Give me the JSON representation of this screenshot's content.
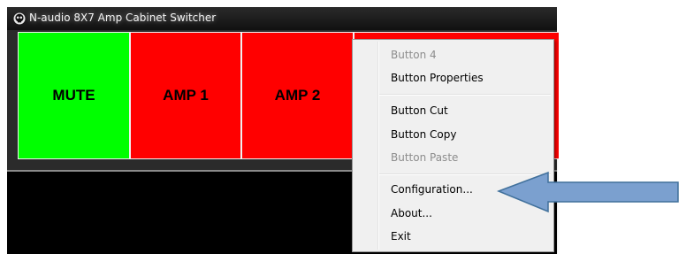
{
  "window": {
    "title": "N-audio 8X7 Amp Cabinet Switcher",
    "icon": "skull-icon"
  },
  "buttons": [
    {
      "label": "MUTE",
      "color": "#00ff00"
    },
    {
      "label": "AMP 1",
      "color": "#ff0000"
    },
    {
      "label": "AMP 2",
      "color": "#ff0000"
    }
  ],
  "context_menu": {
    "items": [
      {
        "label": "Button 4",
        "enabled": false
      },
      {
        "label": "Button Properties",
        "enabled": true
      },
      {
        "label": "Button Cut",
        "enabled": true
      },
      {
        "label": "Button Copy",
        "enabled": true
      },
      {
        "label": "Button Paste",
        "enabled": false
      },
      {
        "label": "Configuration...",
        "enabled": true
      },
      {
        "label": "About...",
        "enabled": true
      },
      {
        "label": "Exit",
        "enabled": true
      }
    ]
  },
  "annotation": {
    "arrow_color": "#7ba0cf",
    "arrow_outline": "#41719c"
  }
}
